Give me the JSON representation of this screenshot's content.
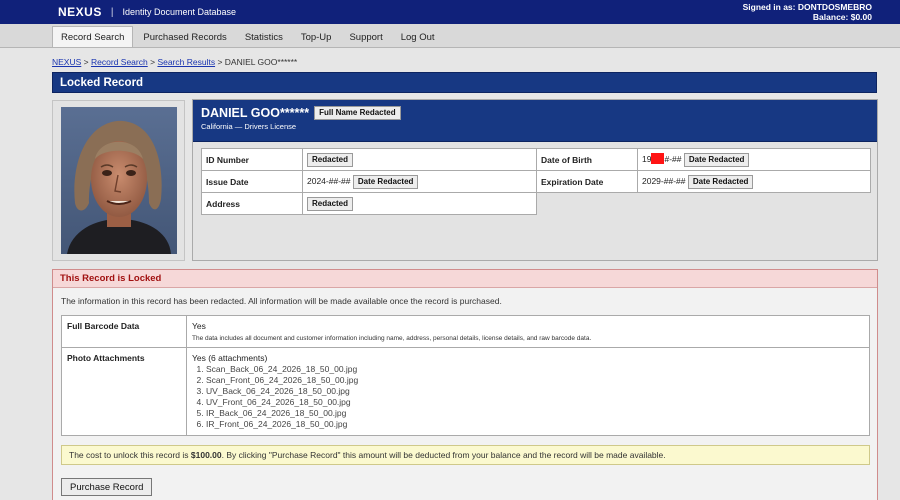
{
  "header": {
    "brand": "NEXUS",
    "separator": "|",
    "subtitle": "Identity Document Database",
    "signed_in": "Signed in as: DONTDOSMEBRO",
    "balance": "Balance: $0.00"
  },
  "nav": {
    "items": [
      {
        "label": "Record Search",
        "active": true
      },
      {
        "label": "Purchased Records",
        "active": false
      },
      {
        "label": "Statistics",
        "active": false
      },
      {
        "label": "Top-Up",
        "active": false
      },
      {
        "label": "Support",
        "active": false
      },
      {
        "label": "Log Out",
        "active": false
      }
    ]
  },
  "breadcrumb": {
    "items": [
      "NEXUS",
      "Record Search",
      "Search Results"
    ],
    "separator": ">",
    "current": "DANIEL GOO******"
  },
  "page": {
    "title": "Locked Record"
  },
  "record": {
    "name": "DANIEL GOO******",
    "name_badge": "Full Name Redacted",
    "subtitle": "California — Drivers License",
    "fields": {
      "id_number": {
        "label": "ID Number",
        "badge": "Redacted"
      },
      "issue_date": {
        "label": "Issue Date",
        "value": "2024-##-##",
        "badge": "Date Redacted"
      },
      "address": {
        "label": "Address",
        "badge": "Redacted"
      },
      "dob": {
        "label": "Date of Birth",
        "value_prefix": "19",
        "value_suffix": "#-##",
        "badge": "Date Redacted"
      },
      "expiration_date": {
        "label": "Expiration Date",
        "value": "2029-##-##",
        "badge": "Date Redacted"
      }
    }
  },
  "locked": {
    "title": "This Record is Locked",
    "message": "The information in this record has been redacted. All information will be made available once the record is purchased.",
    "barcode": {
      "label": "Full Barcode Data",
      "value": "Yes",
      "note": "The data includes all document and customer information including name, address, personal details, license details, and raw barcode data."
    },
    "photos": {
      "label": "Photo Attachments",
      "value": "Yes (6 attachments)",
      "files": [
        "Scan_Back_06_24_2026_18_50_00.jpg",
        "Scan_Front_06_24_2026_18_50_00.jpg",
        "UV_Back_06_24_2026_18_50_00.jpg",
        "UV_Front_06_24_2026_18_50_00.jpg",
        "IR_Back_06_24_2026_18_50_00.jpg",
        "IR_Front_06_24_2026_18_50_00.jpg"
      ]
    },
    "cost": {
      "prefix": "The cost to unlock this record is ",
      "amount": "$100.00",
      "suffix": ". By clicking \"Purchase Record\" this amount will be deducted from your balance and the record will be made available."
    },
    "button": "Purchase Record"
  },
  "colors": {
    "topbar": "#10217a",
    "title_bar": "#173883",
    "locked_accent": "#a11111",
    "redaction": "#ff1414",
    "cost_bg": "#fbf9cf"
  }
}
